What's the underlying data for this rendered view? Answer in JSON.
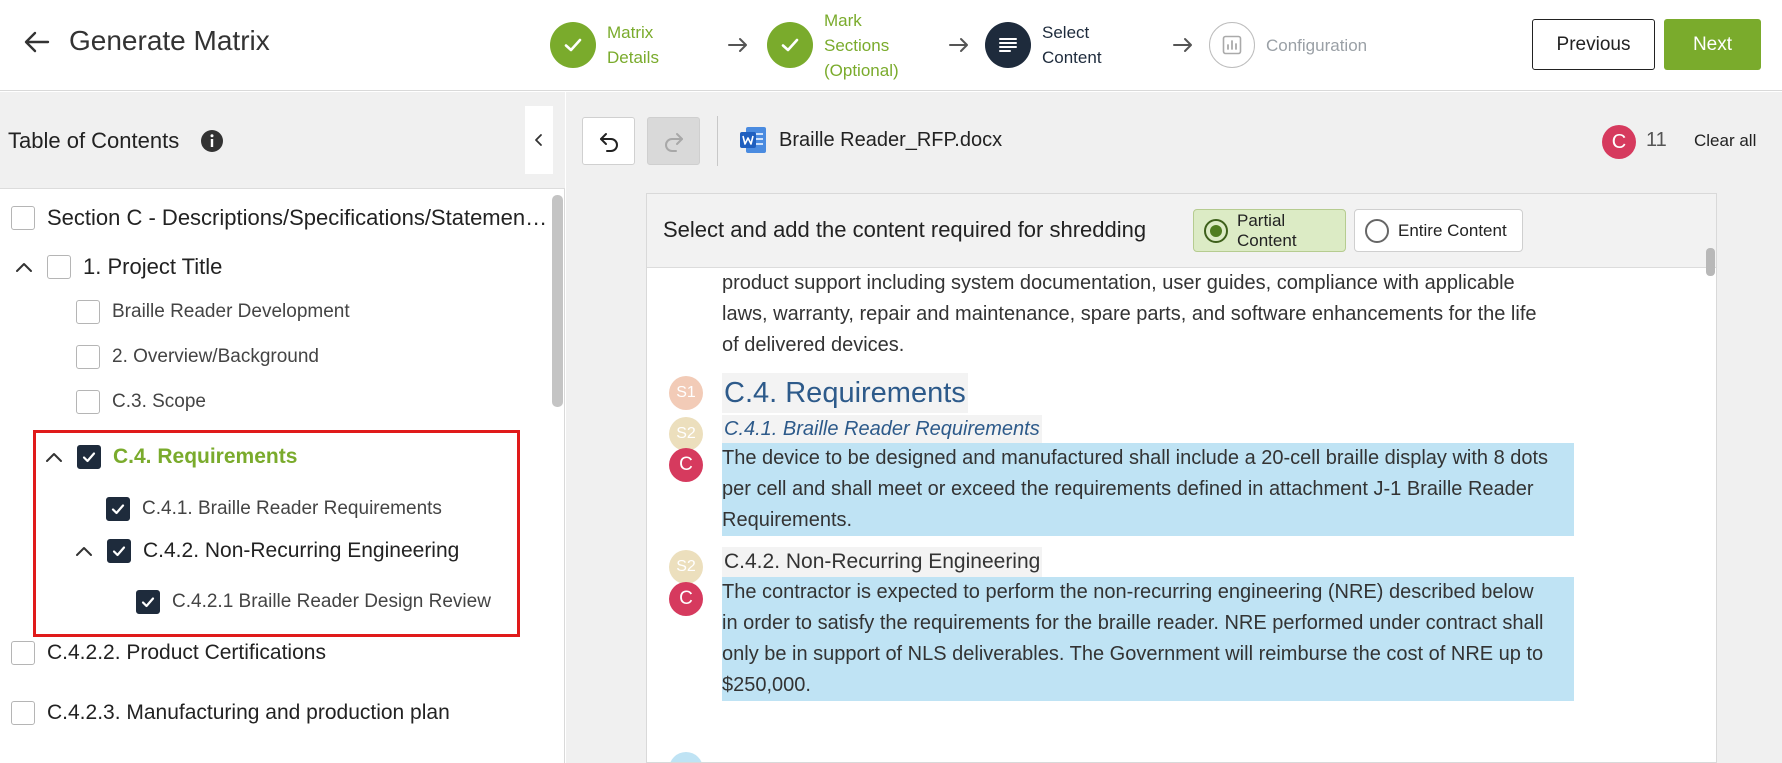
{
  "header": {
    "title": "Generate Matrix",
    "steps": [
      {
        "label": "Matrix Details",
        "state": "done"
      },
      {
        "label": "Mark Sections",
        "label2": "(Optional)",
        "state": "done"
      },
      {
        "label": "Select Content",
        "state": "active"
      },
      {
        "label": "Configuration",
        "state": "pending"
      }
    ],
    "previous_label": "Previous",
    "next_label": "Next"
  },
  "toc": {
    "title": "Table of Contents",
    "items": [
      {
        "label": "Section C - Descriptions/Specifications/Statement of Work",
        "checked": false
      },
      {
        "label": "1. Project Title",
        "checked": false
      },
      {
        "label": "Braille Reader Development",
        "checked": false
      },
      {
        "label": "2. Overview/Background",
        "checked": false
      },
      {
        "label": "C.3. Scope",
        "checked": false
      },
      {
        "label": "C.4. Requirements",
        "checked": true
      },
      {
        "label": "C.4.1. Braille Reader Requirements",
        "checked": true
      },
      {
        "label": "C.4.2. Non-Recurring Engineering",
        "checked": true
      },
      {
        "label": "C.4.2.1 Braille Reader Design Review",
        "checked": true
      },
      {
        "label": "C.4.2.2. Product Certifications",
        "checked": false
      },
      {
        "label": "C.4.2.3. Manufacturing and production plan",
        "checked": false
      }
    ]
  },
  "toolbar": {
    "file_name": "Braille Reader_RFP.docx",
    "badge_letter": "C",
    "count": "11",
    "clear_all_label": "Clear all"
  },
  "content": {
    "instruction": "Select and add the content required for shredding",
    "options": [
      {
        "label": "Partial Content",
        "selected": true
      },
      {
        "label": "Entire Content",
        "selected": false
      }
    ],
    "lines_intro": [
      "product support including system documentation, user guides, compliance with applicable",
      "laws, warranty, repair and maintenance, spare parts, and software enhancements for the life",
      "of delivered devices."
    ],
    "badges": {
      "s1": "S1",
      "s2": "S2",
      "c": "C"
    },
    "h_req": "C.4. Requirements",
    "h_braille_req": "C.4.1. Braille Reader Requirements",
    "para_braille": [
      "The device to be designed and manufactured shall include a 20-cell braille display with 8 dots",
      "per cell and shall meet or exceed the requirements defined in attachment J-1 Braille Reader",
      "Requirements."
    ],
    "h_nre": "C.4.2. Non-Recurring Engineering",
    "para_nre": [
      "The contractor is expected to perform the non-recurring engineering (NRE) described below",
      "in order to satisfy the requirements for the braille reader. NRE performed under contract shall",
      "only be in support of NLS deliverables. The Government will reimburse the cost of NRE up to",
      "$250,000."
    ]
  },
  "colors": {
    "accent_green": "#7aab2c",
    "active_navy": "#1e2b3c",
    "badge_red": "#d63a5e",
    "highlight_blue": "#bfe3f4",
    "selection_red": "#e01a1a"
  }
}
